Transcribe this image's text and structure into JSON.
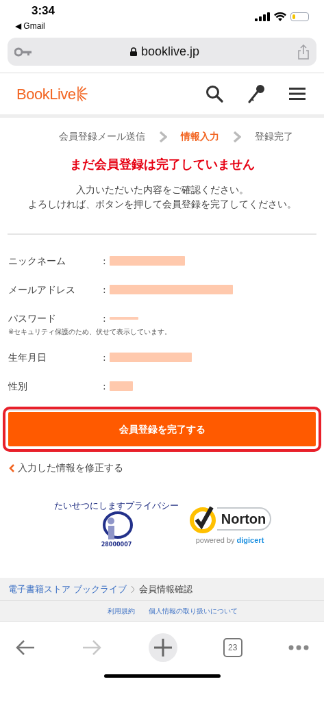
{
  "status_bar": {
    "time": "3:34",
    "back_app": "◀ Gmail"
  },
  "address_bar": {
    "url": "booklive.jp"
  },
  "header": {
    "logo": "BookLive"
  },
  "steps": [
    {
      "label": "会員登録メール送信",
      "selected": false
    },
    {
      "label": "情報入力",
      "selected": true
    },
    {
      "label": "登録完了",
      "selected": false
    }
  ],
  "warning": "まだ会員登録は完了していません",
  "instructions": [
    "入力いただいた内容をご確認ください。",
    "よろしければ、ボタンを押して会員登録を完了してください。"
  ],
  "fields": [
    {
      "label": "ニックネーム",
      "separator": ":"
    },
    {
      "label": "メールアドレス",
      "separator": ":"
    },
    {
      "label": "パスワード",
      "separator": ":",
      "note": "※セキュリティ保護のため、伏せて表示しています。"
    },
    {
      "label": "生年月日",
      "separator": ":"
    },
    {
      "label": "性別",
      "separator": ":"
    }
  ],
  "submit_button": "会員登録を完了する",
  "back_link": "入力した情報を修正する",
  "badges": {
    "privacy_mark": {
      "caption": "たいせつにしますプライバシー",
      "number": "28000007"
    },
    "norton": {
      "name": "Norton",
      "powered": "powered by",
      "brand": "digicert"
    }
  },
  "breadcrumb": [
    "電子書籍ストア ブックライブ",
    "会員情報確認"
  ],
  "footer_links": [
    "利用規約",
    "個人情報の取り扱いについて"
  ],
  "toolbar": {
    "tab_count": "23"
  }
}
